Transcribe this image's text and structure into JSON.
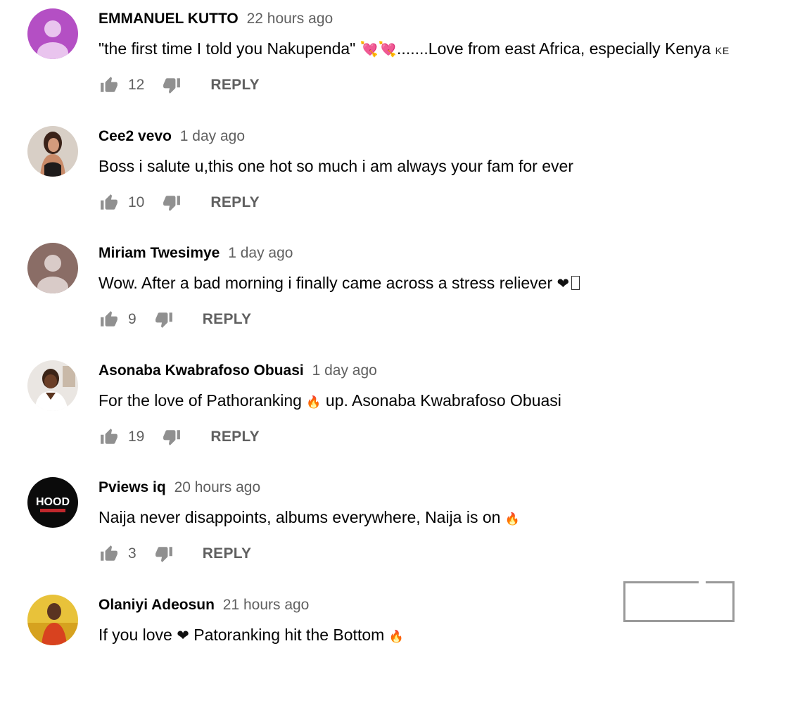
{
  "comments": [
    {
      "author": "EMMANUEL KUTTO",
      "time": "22 hours ago",
      "text_before": "\"the first time I told you Nakupenda\" ",
      "emoji": "💘💘",
      "text_after": ".......Love from east Africa, especially Kenya ",
      "flag": "KE",
      "likes": "12",
      "reply_label": "REPLY",
      "avatar": "default-purple"
    },
    {
      "author": "Cee2 vevo",
      "time": "1 day ago",
      "text": "Boss i salute u,this one hot so much i am always your fam for ever",
      "likes": "10",
      "reply_label": "REPLY",
      "avatar": "photo-woman"
    },
    {
      "author": "Miriam Twesimye",
      "time": "1 day ago",
      "text": "Wow. After a bad morning i finally came across a stress reliever ",
      "emoji": "❤",
      "likes": "9",
      "reply_label": "REPLY",
      "avatar": "default-brown"
    },
    {
      "author": "Asonaba Kwabrafoso Obuasi",
      "time": "1 day ago",
      "text_before": "For the love of Pathoranking ",
      "emoji": "🔥",
      "text_after": " up. Asonaba Kwabrafoso Obuasi",
      "likes": "19",
      "reply_label": "REPLY",
      "avatar": "photo-man"
    },
    {
      "author": "Pviews iq",
      "time": "20 hours ago",
      "text": "Naija never disappoints, albums everywhere, Naija is on ",
      "emoji": "🔥",
      "likes": "3",
      "reply_label": "REPLY",
      "avatar": "logo-hood",
      "avatar_text": "HOOD"
    },
    {
      "author": "Olaniyi Adeosun",
      "time": "21 hours ago",
      "text_before": "If you love ",
      "emoji": "❤",
      "text_after": " Patoranking hit the Bottom ",
      "emoji2": "🔥",
      "avatar": "photo-yellow"
    }
  ],
  "icons": {
    "like": "thumbs-up-icon",
    "dislike": "thumbs-down-icon"
  },
  "colors": {
    "text": "#030303",
    "secondary": "#606060",
    "icon": "#909090"
  }
}
